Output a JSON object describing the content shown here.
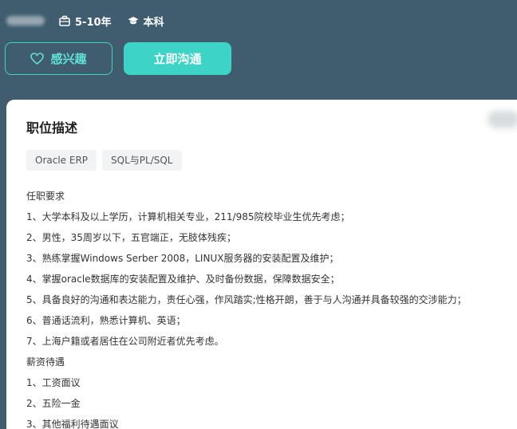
{
  "header": {
    "experience": "5-10年",
    "education": "本科",
    "interest_button": "感兴趣",
    "chat_button": "立即沟通",
    "colors": {
      "header_bg": "#3f5d6f",
      "accent": "#3ed3c7"
    }
  },
  "card": {
    "title": "职位描述",
    "tags": [
      "Oracle ERP",
      "SQL与PL/SQL"
    ],
    "description_lines": [
      "任职要求",
      "1、大学本科及以上学历，计算机相关专业，211/985院校毕业生优先考虑；",
      "2、男性，35周岁以下，五官端正，无肢体残疾；",
      "3、熟练掌握Windows Serber 2008，LINUX服务器的安装配置及维护；",
      "4、掌握oracle数据库的安装配置及维护、及时备份数据，保障数据安全；",
      "5、具备良好的沟通和表达能力，责任心强，作风踏实;性格开朗，善于与人沟通并具备较强的交涉能力；",
      "6、普通话流利，熟悉计算机、英语；",
      "7、上海户籍或者居住在公司附近者优先考虑。",
      "薪资待遇",
      "1、工资面议",
      "2、五险一金",
      "3、其他福利待遇面议"
    ]
  },
  "icons": {
    "experience": "briefcase-icon",
    "education": "graduation-cap-icon",
    "interest": "heart-icon"
  }
}
